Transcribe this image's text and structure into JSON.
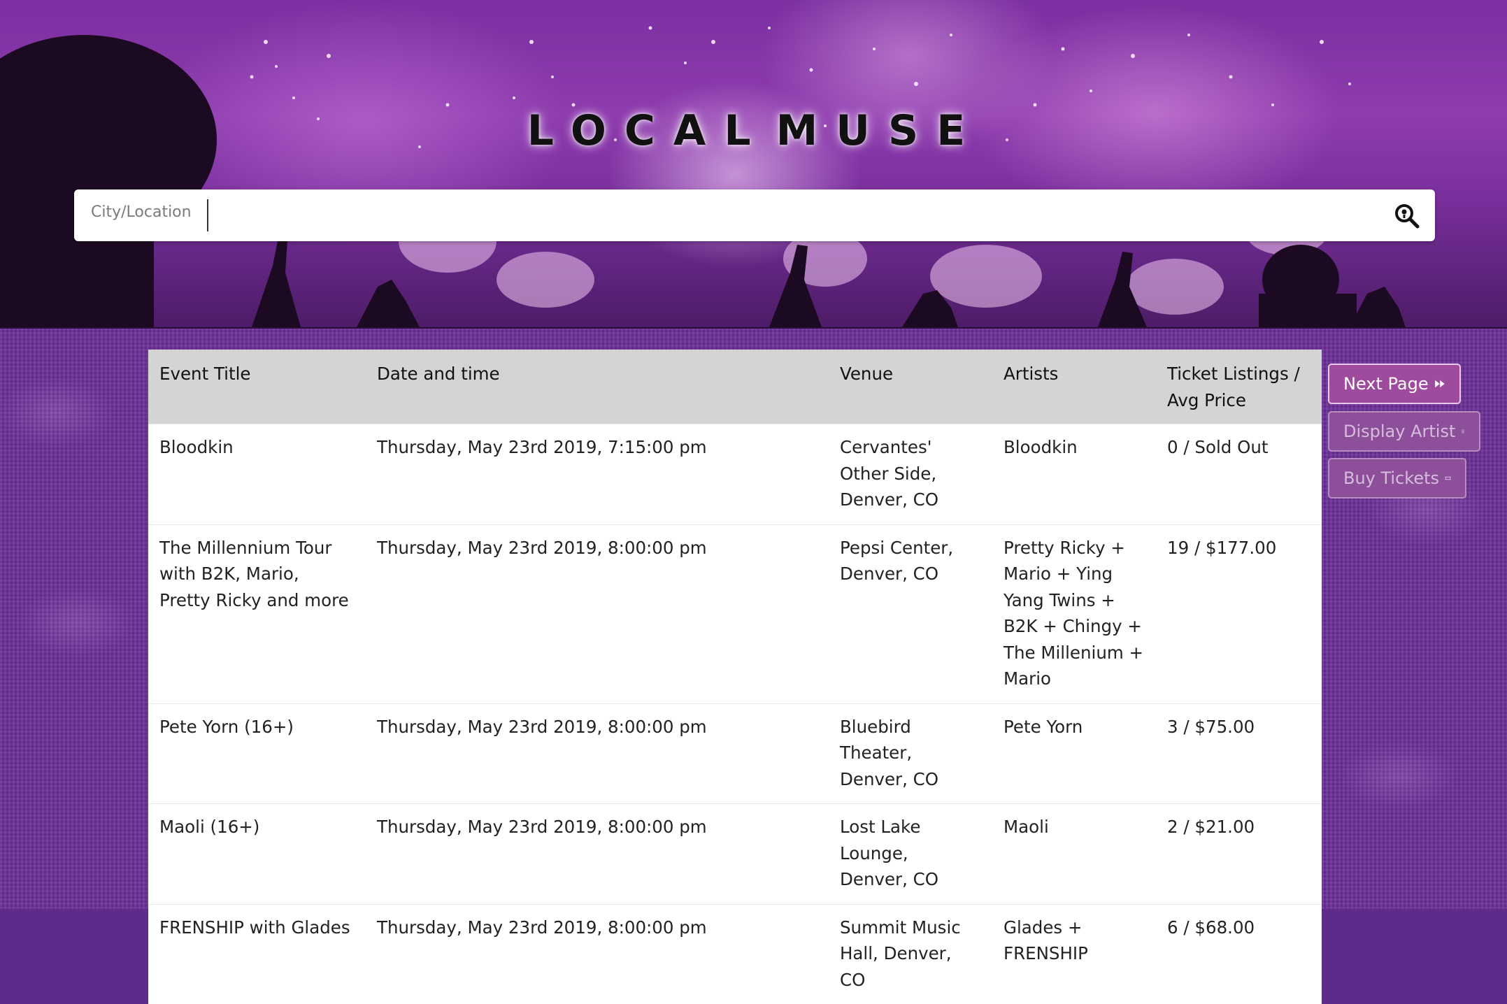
{
  "app": {
    "logo_text_left": "LOCAL",
    "logo_text_right": "MUSE",
    "logo_icon": "music-note-icon"
  },
  "search": {
    "label": "City/Location",
    "value": "",
    "icon": "search-location-icon"
  },
  "table": {
    "headers": {
      "event_title": "Event Title",
      "date_time": "Date and time",
      "venue": "Venue",
      "artists": "Artists",
      "tickets": "Ticket Listings / Avg Price"
    },
    "rows": [
      {
        "event_title": "Bloodkin",
        "date_time": "Thursday, May 23rd 2019, 7:15:00 pm",
        "venue": "Cervantes' Other Side, Denver, CO",
        "artists": "Bloodkin",
        "tickets": "0 / Sold Out"
      },
      {
        "event_title": "The Millennium Tour with B2K, Mario, Pretty Ricky and more",
        "date_time": "Thursday, May 23rd 2019, 8:00:00 pm",
        "venue": "Pepsi Center, Denver, CO",
        "artists": "Pretty Ricky + Mario + Ying Yang Twins + B2K + Chingy + The Millenium + Mario",
        "tickets": "19 / $177.00"
      },
      {
        "event_title": "Pete Yorn (16+)",
        "date_time": "Thursday, May 23rd 2019, 8:00:00 pm",
        "venue": "Bluebird Theater, Denver, CO",
        "artists": "Pete Yorn",
        "tickets": "3 / $75.00"
      },
      {
        "event_title": "Maoli (16+)",
        "date_time": "Thursday, May 23rd 2019, 8:00:00 pm",
        "venue": "Lost Lake Lounge, Denver, CO",
        "artists": "Maoli",
        "tickets": "2 / $21.00"
      },
      {
        "event_title": "FRENSHIP with Glades",
        "date_time": "Thursday, May 23rd 2019, 8:00:00 pm",
        "venue": "Summit Music Hall, Denver, CO",
        "artists": "Glades + FRENSHIP",
        "tickets": "6 / $68.00"
      }
    ]
  },
  "actions": {
    "next_page": "Next Page",
    "next_page_icon": "fast-forward-icon",
    "display_artist": "Display Artist",
    "display_artist_icon": "contact-card-icon",
    "buy_tickets": "Buy Tickets",
    "buy_tickets_icon": "ticket-icon"
  },
  "colors": {
    "brand_purple": "#6b2f96",
    "active_button": "#9e4a9d",
    "disabled_button": "#8d4f9a",
    "table_header": "#d4d4d4"
  }
}
